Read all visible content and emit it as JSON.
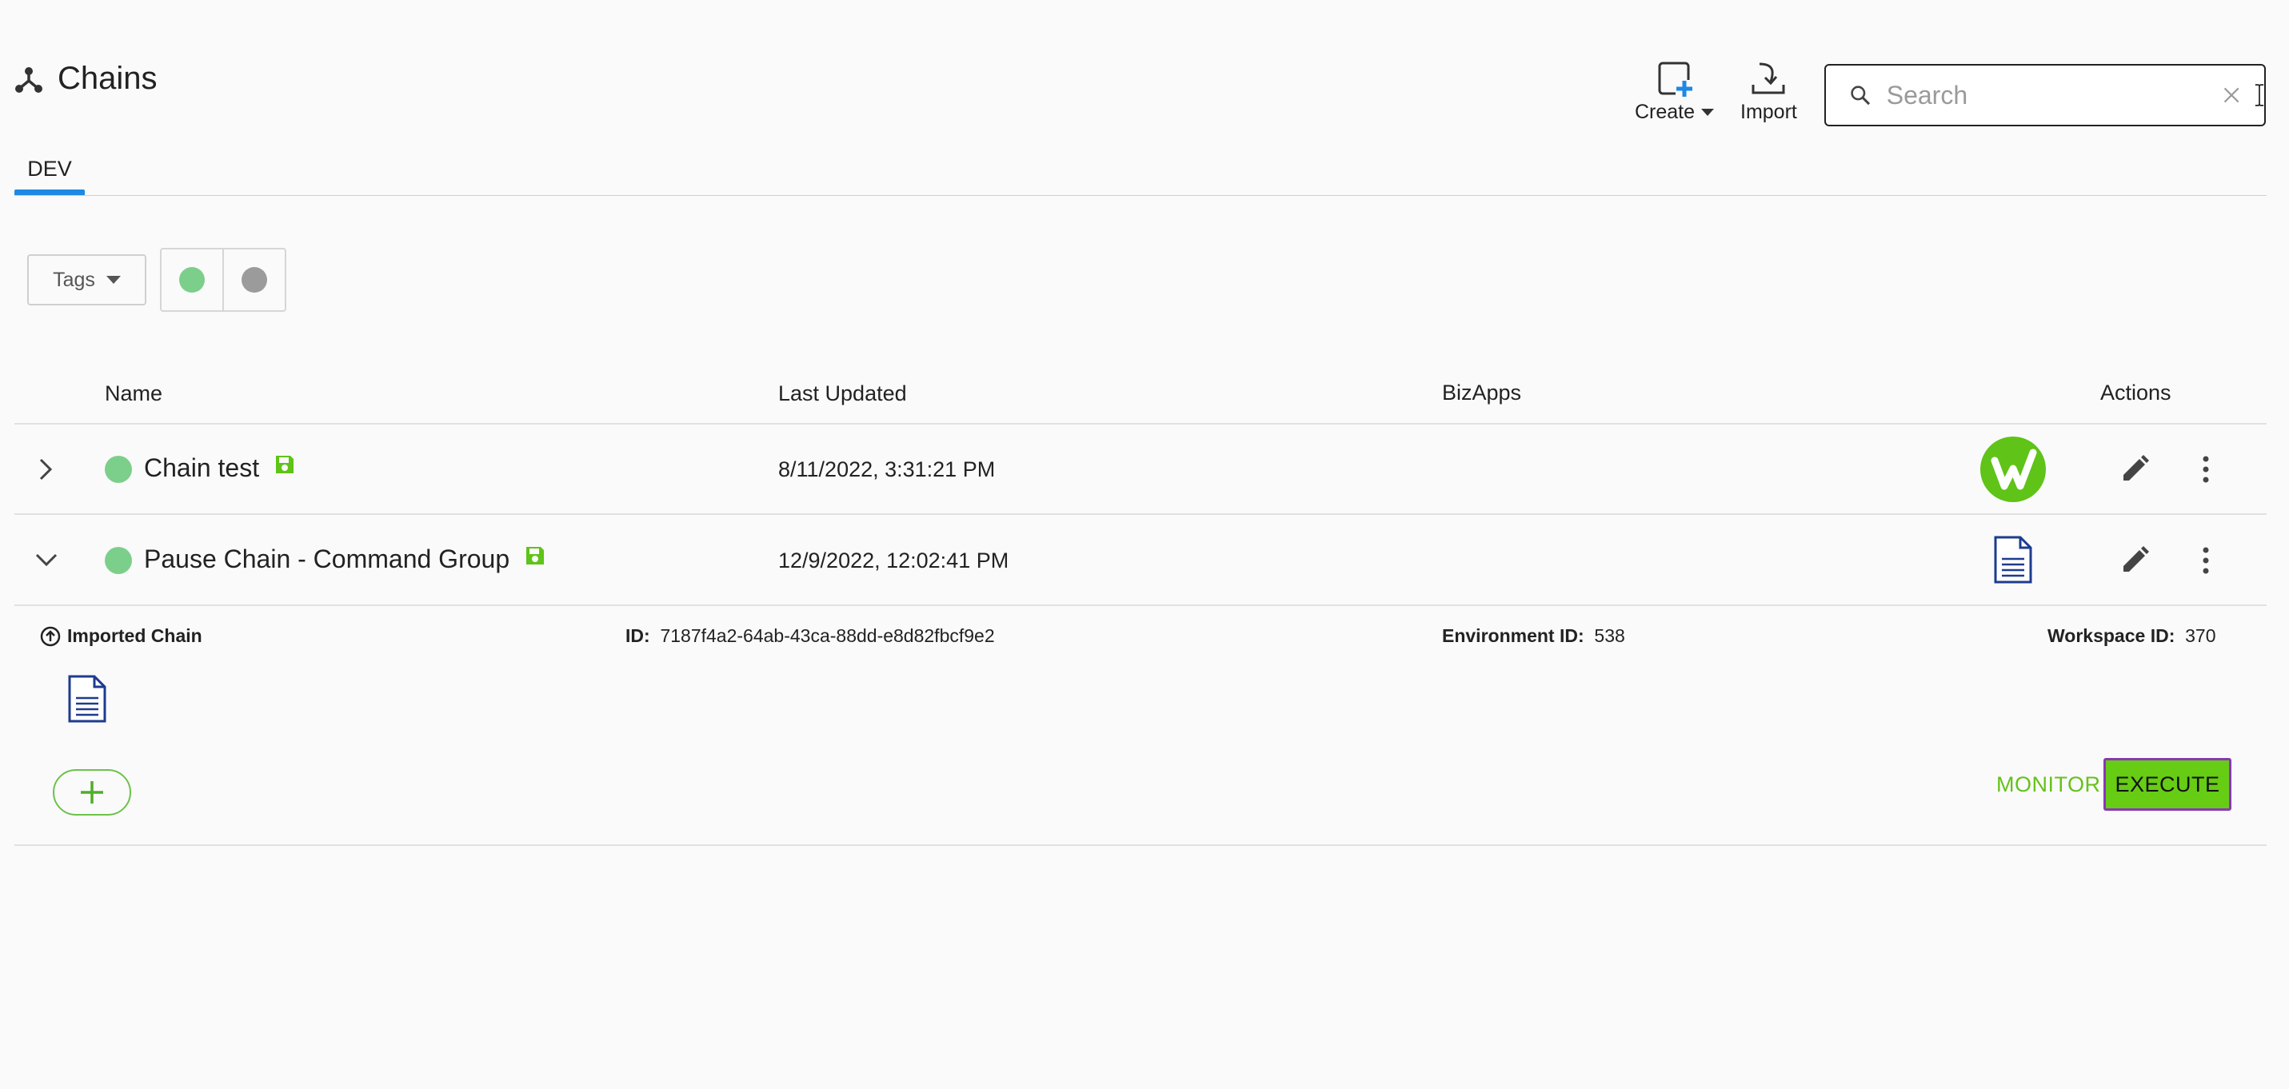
{
  "header": {
    "title": "Chains",
    "create_label": "Create",
    "import_label": "Import"
  },
  "search": {
    "placeholder": "Search",
    "value": ""
  },
  "tabs": [
    {
      "label": "DEV",
      "active": true
    }
  ],
  "filters": {
    "tags_label": "Tags",
    "status_colors": {
      "active": "#7ccf8a",
      "inactive": "#9b9b9b"
    }
  },
  "table": {
    "columns": [
      "Name",
      "Last Updated",
      "BizApps",
      "Actions"
    ],
    "rows": [
      {
        "name": "Chain test",
        "last_updated": "8/11/2022, 3:31:21 PM",
        "bizapp_icon": "workfront-logo-icon",
        "expanded": false
      },
      {
        "name": "Pause Chain - Command Group",
        "last_updated": "12/9/2022, 12:02:41 PM",
        "bizapp_icon": "document-icon",
        "expanded": true
      }
    ]
  },
  "details": {
    "imported_label": "Imported Chain",
    "id_label": "ID:",
    "id_value": "7187f4a2-64ab-43ca-88dd-e8d82fbcf9e2",
    "env_label": "Environment ID:",
    "env_value": "538",
    "workspace_label": "Workspace ID:",
    "workspace_value": "370"
  },
  "buttons": {
    "monitor": "MONITOR",
    "execute": "EXECUTE"
  },
  "colors": {
    "accent_blue": "#1e88e5",
    "brand_green": "#65c21a",
    "execute_border": "#8a36b8",
    "doc_blue": "#1d3b8f"
  }
}
